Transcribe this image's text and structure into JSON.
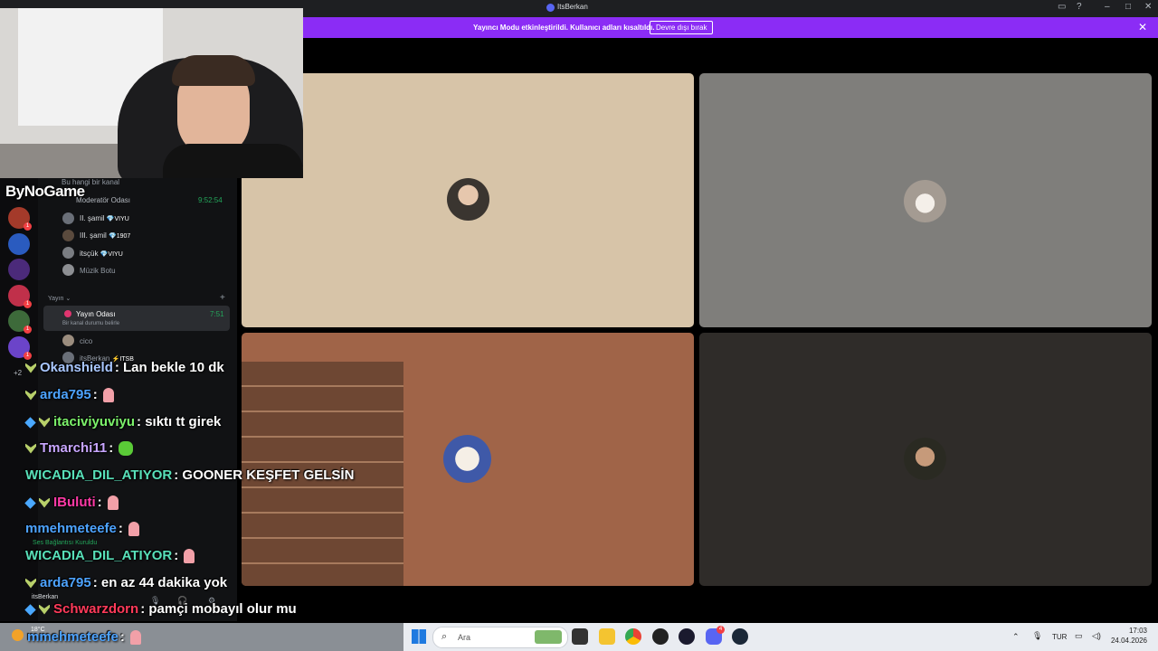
{
  "window": {
    "title": "ItsBerkan"
  },
  "banner": {
    "message": "Yayıncı Modu etkinleştirildi. Kullanıcı adları kısaltıldı.",
    "button_label": "Devre dışı bırak"
  },
  "overlay": {
    "brand": "ByNoGame"
  },
  "sidebar": {
    "servers_more": "+2",
    "channels": {
      "top_channel": "Bu hangi bir kanal",
      "moderator_room": "Moderatör Odası",
      "moderator_time": "9:52:54",
      "members": [
        {
          "name": "II. şamil",
          "tag": "VIYU"
        },
        {
          "name": "III. şamil",
          "tag": "1907"
        },
        {
          "name": "itsçük",
          "tag": "VIYU"
        },
        {
          "name": "Müzik Botu",
          "tag": ""
        }
      ],
      "category_yayin": "Yayın",
      "stream_room": "Yayın Odası",
      "stream_time": "7:51",
      "stream_status": "Bir kanal durumu belirle",
      "stream_members": [
        {
          "name": "cico",
          "tag": ""
        },
        {
          "name": "itsBerkan",
          "tag": "ITSB"
        }
      ],
      "voice_status": "Ses Bağlantısı Kuruldu",
      "user_name": "itsBerkan"
    }
  },
  "chat": [
    {
      "user": "Okanshield",
      "color": "#a9c7ff",
      "text": ": Lan bekle 10 dk",
      "emote": ""
    },
    {
      "user": "arda795",
      "color": "#4da3ff",
      "text": ":",
      "emote": "pat"
    },
    {
      "user": "itaciviyuviyu",
      "color": "#7cf26b",
      "text": ": sıktı tt girek",
      "emote": ""
    },
    {
      "user": "Tmarchi11",
      "color": "#c8a6ff",
      "text": ":",
      "emote": "frog"
    },
    {
      "user": "WICADIA_DIL_ATIYOR",
      "color": "#58e0b9",
      "text": ": GOONER KEŞFET GELSİN",
      "emote": ""
    },
    {
      "user": "IBuluti",
      "color": "#ff3aa7",
      "text": ":",
      "emote": "pat"
    },
    {
      "user": "mmehmeteefe",
      "color": "#4da3ff",
      "text": ":",
      "emote": "pat"
    },
    {
      "user": "WICADIA_DIL_ATIYOR",
      "color": "#58e0b9",
      "text": ":",
      "emote": "pat"
    },
    {
      "user": "arda795",
      "color": "#4da3ff",
      "text": ": en az 44 dakika yok",
      "emote": ""
    },
    {
      "user": "Schwarzdorn",
      "color": "#ff3a5a",
      "text": ": pamçi mobayıl olur mu",
      "emote": ""
    },
    {
      "user": "mmehmeteefe",
      "color": "#4da3ff",
      "text": ":",
      "emote": "pat"
    }
  ],
  "taskbar": {
    "search_placeholder": "Ara",
    "weather": "18°C",
    "language": "TUR",
    "time": "17:03",
    "date": "24.04.2026",
    "discord_badge": "4"
  },
  "colors": {
    "accent": "#8b2cf5",
    "tile1": "#d7c4a8",
    "tile2": "#7f7e7b",
    "tile3": "#a06448",
    "tile4": "#2f2c29"
  }
}
